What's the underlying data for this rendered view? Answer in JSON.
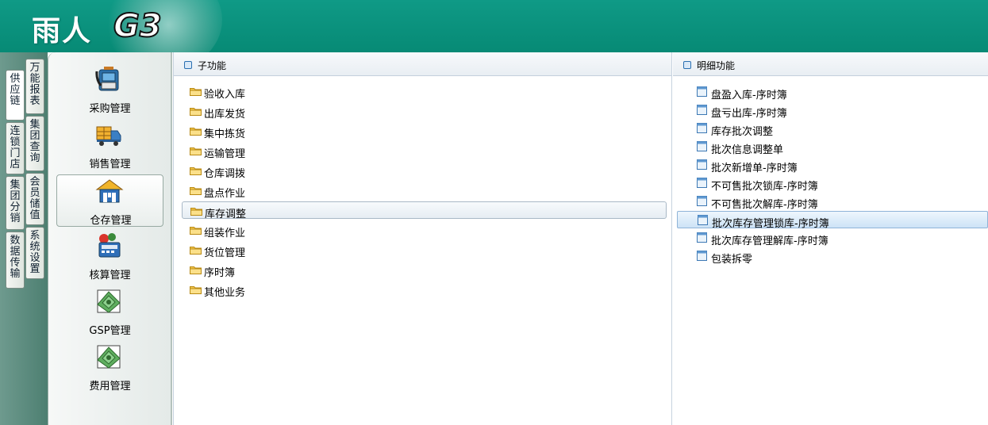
{
  "header": {
    "logo_cn": "雨人",
    "logo_g3": "G3"
  },
  "vtabs": [
    {
      "label": "供应链",
      "active": true
    },
    {
      "label": "万能报表"
    },
    {
      "label": "连锁门店"
    },
    {
      "label": "集团查询"
    },
    {
      "label": "集团分销"
    },
    {
      "label": "会员储值"
    },
    {
      "label": "数据传输"
    },
    {
      "label": "系统设置"
    }
  ],
  "modules": [
    {
      "label": "采购管理",
      "icon": "phone-icon"
    },
    {
      "label": "销售管理",
      "icon": "truck-icon"
    },
    {
      "label": "仓存管理",
      "icon": "warehouse-icon",
      "active": true
    },
    {
      "label": "核算管理",
      "icon": "calculator-icon"
    },
    {
      "label": "GSP管理",
      "icon": "money-icon"
    },
    {
      "label": "费用管理",
      "icon": "money-icon"
    }
  ],
  "sub_functions": {
    "title": "子功能",
    "items": [
      "验收入库",
      "出库发货",
      "集中拣货",
      "运输管理",
      "仓库调拨",
      "盘点作业",
      "库存调整",
      "组装作业",
      "货位管理",
      "序时簿",
      "其他业务"
    ],
    "selected": "库存调整"
  },
  "detail_functions": {
    "title": "明细功能",
    "items": [
      "盘盈入库-序时簿",
      "盘亏出库-序时簿",
      "库存批次调整",
      "批次信息调整单",
      "批次新增单-序时簿",
      "不可售批次锁库-序时簿",
      "不可售批次解库-序时簿",
      "批次库存管理锁库-序时簿",
      "批次库存管理解库-序时簿",
      "包装拆零"
    ],
    "highlighted": "批次库存管理锁库-序时簿"
  },
  "colors": {
    "header": "#0a8f7b",
    "accent": "#2a6fb1",
    "folder": "#f3c64b"
  }
}
